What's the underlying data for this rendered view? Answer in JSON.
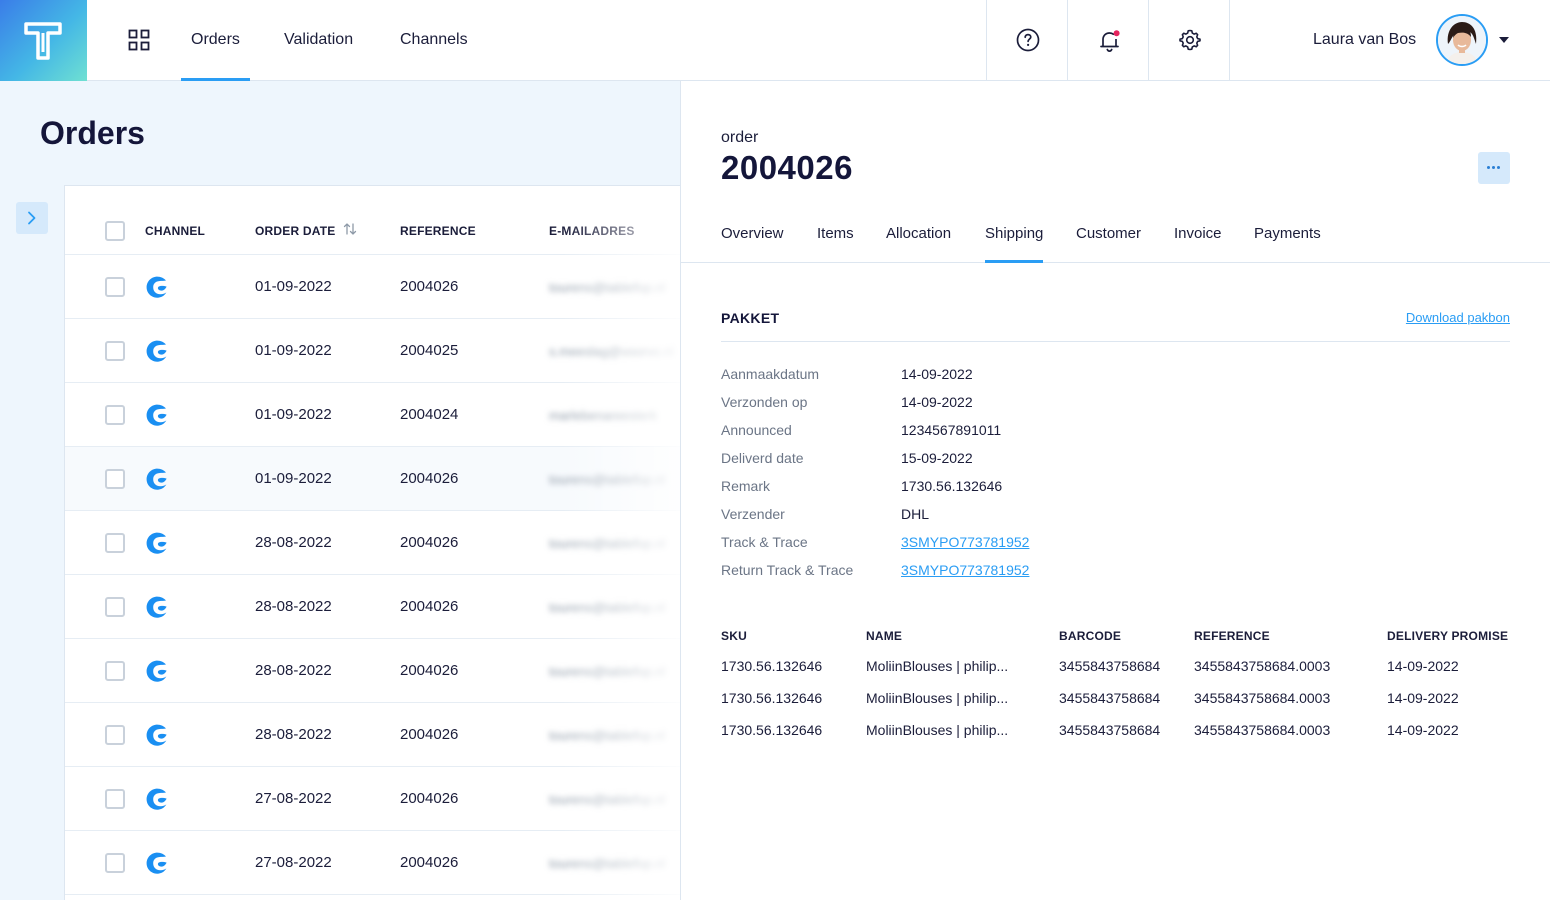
{
  "nav": {
    "items": [
      {
        "label": "Orders",
        "active": true
      },
      {
        "label": "Validation",
        "active": false
      },
      {
        "label": "Channels",
        "active": false
      }
    ],
    "user_name": "Laura van Bos",
    "accent_color": "#2a9df4",
    "icons": [
      "logo-t-icon",
      "apps-grid-icon",
      "help-icon",
      "bell-icon",
      "gear-icon",
      "chevron-down-icon"
    ]
  },
  "list": {
    "title": "Orders",
    "columns": {
      "channel": "CHANNEL",
      "order_date": "ORDER DATE",
      "reference": "REFERENCE",
      "email": "E-MAILADRES"
    },
    "rows": [
      {
        "date": "01-09-2022",
        "reference": "2004026",
        "email": "tourens@tablefop.nl"
      },
      {
        "date": "01-09-2022",
        "reference": "2004025",
        "email": "s.meeslag@voorvo.nl"
      },
      {
        "date": "01-09-2022",
        "reference": "2004024",
        "email": "marlebenareesterk"
      },
      {
        "date": "01-09-2022",
        "reference": "2004026",
        "email": "tourens@tablefop.nl"
      },
      {
        "date": "28-08-2022",
        "reference": "2004026",
        "email": "tourens@tablefop.nl"
      },
      {
        "date": "28-08-2022",
        "reference": "2004026",
        "email": "tourens@tablefop.nl"
      },
      {
        "date": "28-08-2022",
        "reference": "2004026",
        "email": "tourens@tablefop.nl"
      },
      {
        "date": "28-08-2022",
        "reference": "2004026",
        "email": "tourens@tablefop.nl"
      },
      {
        "date": "27-08-2022",
        "reference": "2004026",
        "email": "tourens@tablefop.nl"
      },
      {
        "date": "27-08-2022",
        "reference": "2004026",
        "email": "tourens@tablefop.nl"
      }
    ]
  },
  "detail": {
    "label": "order",
    "number": "2004026",
    "tabs": [
      {
        "label": "Overview",
        "active": false
      },
      {
        "label": "Items",
        "active": false
      },
      {
        "label": "Allocation",
        "active": false
      },
      {
        "label": "Shipping",
        "active": true
      },
      {
        "label": "Customer",
        "active": false
      },
      {
        "label": "Invoice",
        "active": false
      },
      {
        "label": "Payments",
        "active": false
      }
    ],
    "section_title": "PAKKET",
    "download_label": "Download pakbon",
    "fields": [
      {
        "label": "Aanmaakdatum",
        "value": "14-09-2022",
        "link": false
      },
      {
        "label": "Verzonden op",
        "value": "14-09-2022",
        "link": false
      },
      {
        "label": "Announced",
        "value": "1234567891011",
        "link": false
      },
      {
        "label": "Deliverd date",
        "value": "15-09-2022",
        "link": false
      },
      {
        "label": "Remark",
        "value": "1730.56.132646",
        "link": false
      },
      {
        "label": "Verzender",
        "value": "DHL",
        "link": false
      },
      {
        "label": "Track & Trace",
        "value": "3SMYPO773781952",
        "link": true
      },
      {
        "label": "Return Track & Trace",
        "value": "3SMYPO773781952",
        "link": true
      }
    ],
    "items_columns": {
      "sku": "SKU",
      "name": "NAME",
      "barcode": "BARCODE",
      "reference": "REFERENCE",
      "delivery_promise": "DELIVERY PROMISE"
    },
    "items": [
      {
        "sku": "1730.56.132646",
        "name": "MoliinBlouses | philip...",
        "barcode": "3455843758684",
        "reference": "3455843758684.0003",
        "delivery_promise": "14-09-2022"
      },
      {
        "sku": "1730.56.132646",
        "name": "MoliinBlouses | philip...",
        "barcode": "3455843758684",
        "reference": "3455843758684.0003",
        "delivery_promise": "14-09-2022"
      },
      {
        "sku": "1730.56.132646",
        "name": "MoliinBlouses | philip...",
        "barcode": "3455843758684",
        "reference": "3455843758684.0003",
        "delivery_promise": "14-09-2022"
      }
    ]
  }
}
